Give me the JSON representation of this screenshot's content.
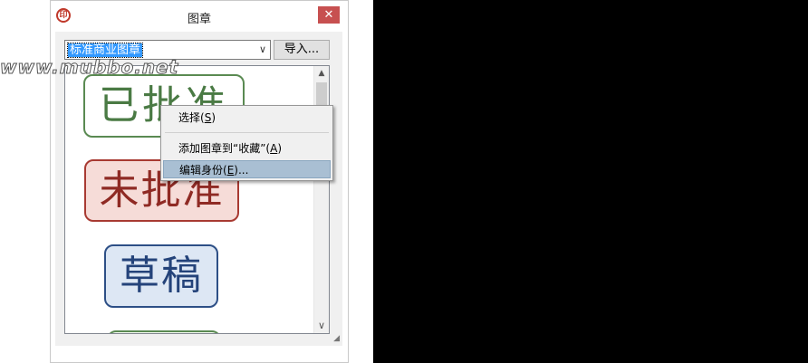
{
  "window": {
    "title": "图章",
    "app_icon_glyph": "印",
    "close_glyph": "✕"
  },
  "toolbar": {
    "combo_value": "标准商业图章",
    "combo_arrow": "∨",
    "import_label": "导入..."
  },
  "stamps": [
    {
      "text": "已批准",
      "color": "#4a7a44"
    },
    {
      "text": "未批准",
      "color": "#8f2a24"
    },
    {
      "text": "草稿",
      "color": "#24437a"
    },
    {
      "text": "",
      "color": "#5a8a52"
    }
  ],
  "scrollbar": {
    "up_glyph": "▲",
    "down_glyph": "∨"
  },
  "context_menu": {
    "items": [
      {
        "label": "选择(",
        "key": "S",
        "suffix": ")"
      },
      {
        "label": "添加图章到“收藏”(",
        "key": "A",
        "suffix": ")"
      },
      {
        "label": "编辑身份(",
        "key": "E",
        "suffix": ")..."
      }
    ]
  },
  "watermark": "www.mubbo.net",
  "icons": {
    "resize_grip": "resize-grip-icon"
  }
}
